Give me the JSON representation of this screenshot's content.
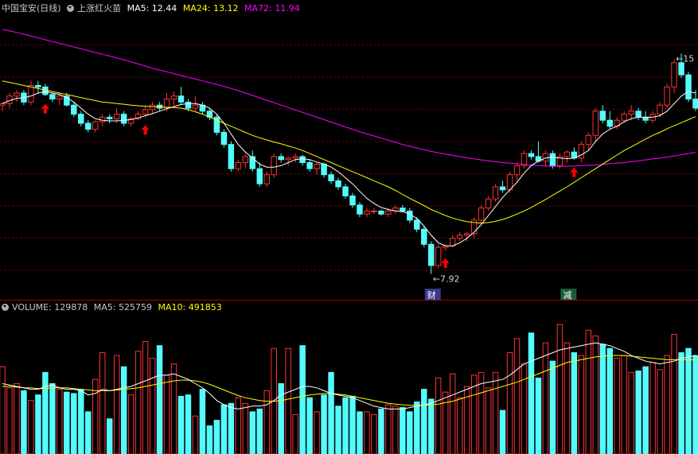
{
  "price_header": {
    "stock_name": "中国宝安(日线)",
    "indicator_name": "上涨红火苗",
    "ma5": "MA5: 12.44",
    "ma24": "MA24: 13.12",
    "ma72": "MA72: 11.94"
  },
  "volume_header": {
    "volume": "VOLUME: 129878",
    "ma5": "MA5: 525759",
    "ma10": "MA10: 491853"
  },
  "colors": {
    "up": "#ff3232",
    "down": "#54fcfc",
    "ma5": "#ffffff",
    "ma24": "#ffff00",
    "ma72": "#ff00ff",
    "grid": "#7a0000",
    "arrow": "#ff0000"
  },
  "chart_data": {
    "type": "candlestick",
    "price": {
      "ylim": [
        7.2,
        16.5
      ],
      "candles": [
        [
          13.5,
          13.6,
          13.3,
          13.55
        ],
        [
          13.55,
          13.9,
          13.4,
          13.8
        ],
        [
          13.8,
          14.0,
          13.6,
          13.9
        ],
        [
          13.9,
          14.0,
          13.5,
          13.6
        ],
        [
          13.6,
          14.3,
          13.5,
          14.15
        ],
        [
          14.15,
          14.3,
          13.9,
          14.1
        ],
        [
          14.1,
          14.2,
          13.8,
          13.85
        ],
        [
          13.85,
          13.9,
          13.6,
          13.7
        ],
        [
          13.7,
          13.9,
          13.5,
          13.8
        ],
        [
          13.8,
          13.9,
          13.45,
          13.5
        ],
        [
          13.5,
          13.6,
          13.1,
          13.2
        ],
        [
          13.2,
          13.3,
          12.8,
          12.9
        ],
        [
          12.9,
          13.0,
          12.6,
          12.7
        ],
        [
          12.7,
          13.0,
          12.6,
          12.95
        ],
        [
          12.95,
          13.2,
          12.8,
          13.1
        ],
        [
          13.1,
          13.2,
          12.9,
          13.05
        ],
        [
          13.05,
          13.4,
          12.9,
          13.2
        ],
        [
          13.2,
          13.3,
          12.8,
          12.9
        ],
        [
          12.9,
          13.1,
          12.8,
          13.05
        ],
        [
          13.05,
          13.3,
          13.0,
          13.2
        ],
        [
          13.2,
          13.5,
          13.1,
          13.35
        ],
        [
          13.35,
          13.6,
          13.2,
          13.5
        ],
        [
          13.5,
          13.6,
          13.3,
          13.4
        ],
        [
          13.4,
          13.9,
          13.3,
          13.7
        ],
        [
          13.7,
          13.95,
          13.5,
          13.8
        ],
        [
          13.8,
          14.1,
          13.5,
          13.6
        ],
        [
          13.6,
          13.7,
          13.3,
          13.4
        ],
        [
          13.4,
          13.8,
          13.3,
          13.5
        ],
        [
          13.5,
          13.6,
          13.2,
          13.3
        ],
        [
          13.3,
          13.4,
          13.0,
          13.1
        ],
        [
          13.1,
          13.2,
          12.5,
          12.6
        ],
        [
          12.6,
          12.7,
          12.1,
          12.2
        ],
        [
          12.2,
          12.3,
          11.3,
          11.4
        ],
        [
          11.4,
          11.7,
          11.3,
          11.6
        ],
        [
          11.6,
          11.9,
          11.4,
          11.8
        ],
        [
          11.8,
          12.0,
          11.3,
          11.4
        ],
        [
          11.4,
          11.6,
          10.8,
          10.9
        ],
        [
          10.9,
          11.3,
          10.8,
          11.2
        ],
        [
          11.2,
          11.9,
          11.1,
          11.8
        ],
        [
          11.8,
          11.9,
          11.6,
          11.7
        ],
        [
          11.7,
          11.8,
          11.5,
          11.75
        ],
        [
          11.75,
          11.9,
          11.6,
          11.8
        ],
        [
          11.8,
          11.85,
          11.5,
          11.6
        ],
        [
          11.6,
          11.7,
          11.3,
          11.4
        ],
        [
          11.4,
          11.6,
          11.2,
          11.55
        ],
        [
          11.55,
          11.6,
          11.1,
          11.2
        ],
        [
          11.2,
          11.3,
          10.9,
          11.0
        ],
        [
          11.0,
          11.1,
          10.7,
          10.8
        ],
        [
          10.8,
          10.9,
          10.4,
          10.5
        ],
        [
          10.5,
          10.6,
          10.1,
          10.2
        ],
        [
          10.2,
          10.3,
          9.8,
          9.9
        ],
        [
          9.9,
          10.1,
          9.8,
          10.0
        ],
        [
          10.0,
          10.1,
          9.9,
          10.0
        ],
        [
          10.0,
          10.05,
          9.85,
          9.9
        ],
        [
          9.9,
          10.1,
          9.8,
          10.0
        ],
        [
          10.0,
          10.2,
          9.9,
          10.1
        ],
        [
          10.1,
          10.2,
          9.95,
          10.0
        ],
        [
          10.0,
          10.1,
          9.6,
          9.7
        ],
        [
          9.7,
          9.8,
          9.3,
          9.4
        ],
        [
          9.4,
          9.5,
          8.8,
          8.9
        ],
        [
          8.9,
          9.0,
          7.92,
          8.2
        ],
        [
          8.2,
          8.9,
          8.1,
          8.8
        ],
        [
          8.8,
          8.9,
          8.7,
          8.85
        ],
        [
          8.85,
          9.2,
          8.8,
          9.1
        ],
        [
          9.1,
          9.3,
          9.0,
          9.2
        ],
        [
          9.2,
          9.3,
          9.0,
          9.25
        ],
        [
          9.25,
          9.8,
          9.1,
          9.7
        ],
        [
          9.7,
          10.2,
          9.6,
          10.1
        ],
        [
          10.1,
          10.5,
          10.0,
          10.4
        ],
        [
          10.4,
          10.9,
          10.3,
          10.8
        ],
        [
          10.8,
          11.0,
          10.6,
          10.7
        ],
        [
          10.7,
          11.3,
          10.6,
          11.2
        ],
        [
          11.2,
          11.6,
          11.0,
          11.5
        ],
        [
          11.5,
          12.0,
          11.4,
          11.9
        ],
        [
          11.9,
          12.0,
          11.7,
          11.8
        ],
        [
          11.8,
          12.3,
          11.6,
          11.65
        ],
        [
          11.65,
          12.0,
          11.5,
          11.9
        ],
        [
          11.9,
          12.0,
          11.4,
          11.5
        ],
        [
          11.5,
          11.9,
          11.4,
          11.8
        ],
        [
          11.8,
          12.0,
          11.6,
          11.95
        ],
        [
          11.95,
          12.1,
          11.7,
          11.75
        ],
        [
          11.75,
          12.3,
          11.6,
          12.2
        ],
        [
          12.2,
          12.6,
          12.0,
          12.5
        ],
        [
          12.5,
          13.4,
          12.3,
          13.3
        ],
        [
          13.3,
          13.5,
          12.9,
          13.0
        ],
        [
          13.0,
          13.3,
          12.7,
          12.8
        ],
        [
          12.8,
          13.1,
          12.7,
          13.0
        ],
        [
          13.0,
          13.3,
          12.9,
          13.2
        ],
        [
          13.2,
          13.5,
          13.0,
          13.3
        ],
        [
          13.3,
          13.4,
          13.0,
          13.1
        ],
        [
          13.1,
          13.3,
          12.9,
          13.0
        ],
        [
          13.0,
          13.3,
          12.9,
          13.2
        ],
        [
          13.2,
          13.6,
          13.1,
          13.5
        ],
        [
          13.5,
          14.2,
          13.4,
          14.1
        ],
        [
          14.1,
          15.0,
          13.9,
          14.9
        ],
        [
          14.9,
          15.2,
          14.4,
          14.5
        ],
        [
          14.5,
          14.6,
          13.6,
          13.7
        ],
        [
          13.7,
          14.0,
          13.3,
          13.4
        ]
      ],
      "ma5": [
        13.55,
        13.65,
        13.72,
        13.75,
        13.8,
        13.9,
        13.95,
        13.9,
        13.85,
        13.75,
        13.6,
        13.4,
        13.2,
        13.05,
        13.0,
        12.98,
        12.98,
        13.0,
        13.02,
        13.08,
        13.15,
        13.22,
        13.3,
        13.38,
        13.45,
        13.52,
        13.55,
        13.55,
        13.5,
        13.4,
        13.2,
        12.9,
        12.55,
        12.2,
        11.95,
        11.75,
        11.55,
        11.45,
        11.45,
        11.5,
        11.6,
        11.7,
        11.73,
        11.7,
        11.62,
        11.55,
        11.45,
        11.3,
        11.1,
        10.9,
        10.65,
        10.42,
        10.25,
        10.12,
        10.05,
        10.0,
        9.98,
        9.9,
        9.75,
        9.5,
        9.2,
        8.95,
        8.85,
        8.85,
        8.95,
        9.1,
        9.3,
        9.55,
        9.85,
        10.15,
        10.45,
        10.7,
        10.95,
        11.25,
        11.5,
        11.65,
        11.75,
        11.78,
        11.75,
        11.73,
        11.75,
        11.85,
        12.0,
        12.3,
        12.55,
        12.7,
        12.8,
        12.95,
        13.05,
        13.1,
        13.1,
        13.1,
        13.15,
        13.3,
        13.55,
        13.8,
        13.95,
        13.9
      ],
      "ma24": [
        14.3,
        14.25,
        14.2,
        14.15,
        14.1,
        14.05,
        14.0,
        13.95,
        13.9,
        13.85,
        13.8,
        13.75,
        13.7,
        13.65,
        13.6,
        13.58,
        13.55,
        13.53,
        13.5,
        13.48,
        13.46,
        13.45,
        13.44,
        13.43,
        13.42,
        13.4,
        13.35,
        13.28,
        13.2,
        13.1,
        13.0,
        12.9,
        12.8,
        12.7,
        12.6,
        12.5,
        12.42,
        12.35,
        12.28,
        12.22,
        12.15,
        12.08,
        12.0,
        11.9,
        11.8,
        11.7,
        11.6,
        11.5,
        11.4,
        11.3,
        11.2,
        11.1,
        11.0,
        10.9,
        10.8,
        10.68,
        10.55,
        10.42,
        10.3,
        10.18,
        10.05,
        9.95,
        9.85,
        9.77,
        9.7,
        9.65,
        9.62,
        9.6,
        9.62,
        9.66,
        9.72,
        9.8,
        9.9,
        10.0,
        10.12,
        10.25,
        10.38,
        10.52,
        10.66,
        10.8,
        10.95,
        11.1,
        11.25,
        11.4,
        11.55,
        11.7,
        11.85,
        12.0,
        12.12,
        12.25,
        12.38,
        12.5,
        12.6,
        12.72,
        12.82,
        12.92,
        13.02,
        13.12
      ],
      "ma72": [
        16.0,
        15.95,
        15.9,
        15.84,
        15.78,
        15.72,
        15.66,
        15.6,
        15.54,
        15.48,
        15.42,
        15.36,
        15.3,
        15.24,
        15.18,
        15.12,
        15.06,
        15.0,
        14.93,
        14.86,
        14.79,
        14.72,
        14.66,
        14.6,
        14.54,
        14.48,
        14.42,
        14.36,
        14.3,
        14.24,
        14.18,
        14.12,
        14.05,
        13.98,
        13.9,
        13.82,
        13.74,
        13.66,
        13.58,
        13.5,
        13.42,
        13.34,
        13.26,
        13.18,
        13.1,
        13.02,
        12.94,
        12.86,
        12.78,
        12.7,
        12.62,
        12.55,
        12.48,
        12.41,
        12.34,
        12.27,
        12.2,
        12.14,
        12.08,
        12.02,
        11.97,
        11.92,
        11.88,
        11.84,
        11.8,
        11.76,
        11.72,
        11.69,
        11.66,
        11.63,
        11.6,
        11.58,
        11.56,
        11.54,
        11.52,
        11.5,
        11.49,
        11.48,
        11.48,
        11.48,
        11.49,
        11.5,
        11.51,
        11.52,
        11.54,
        11.56,
        11.58,
        11.6,
        11.63,
        11.66,
        11.69,
        11.72,
        11.75,
        11.78,
        11.82,
        11.86,
        11.9,
        11.94
      ],
      "up_arrows": [
        6,
        20,
        62,
        80
      ],
      "annotations": [
        {
          "text": "←7.92",
          "index": 60,
          "value": 7.92
        },
        {
          "text": "←15",
          "index": 94,
          "value": 15.2
        }
      ],
      "event_tags": [
        {
          "text": "财",
          "index": 60
        },
        {
          "text": "减",
          "index": 79
        }
      ]
    },
    "volume": {
      "ylim": [
        0,
        1000000
      ],
      "values": [
        620000,
        470000,
        500000,
        450000,
        380000,
        420000,
        580000,
        500000,
        460000,
        440000,
        430000,
        460000,
        300000,
        530000,
        720000,
        250000,
        700000,
        620000,
        420000,
        730000,
        800000,
        680000,
        770000,
        560000,
        640000,
        410000,
        420000,
        270000,
        460000,
        200000,
        240000,
        350000,
        360000,
        400000,
        360000,
        300000,
        320000,
        450000,
        750000,
        500000,
        750000,
        280000,
        770000,
        400000,
        300000,
        420000,
        580000,
        340000,
        400000,
        410000,
        300000,
        300000,
        280000,
        320000,
        350000,
        340000,
        330000,
        300000,
        370000,
        460000,
        390000,
        540000,
        440000,
        570000,
        400000,
        480000,
        560000,
        580000,
        470000,
        580000,
        310000,
        720000,
        820000,
        640000,
        860000,
        540000,
        790000,
        660000,
        920000,
        790000,
        720000,
        700000,
        880000,
        840000,
        780000,
        750000,
        680000,
        700000,
        580000,
        590000,
        620000,
        650000,
        600000,
        700000,
        850000,
        720000,
        750000,
        700000
      ],
      "ma5": [
        500000,
        490000,
        480000,
        470000,
        460000,
        460000,
        480000,
        490000,
        470000,
        460000,
        460000,
        450000,
        420000,
        430000,
        460000,
        450000,
        460000,
        470000,
        480000,
        500000,
        520000,
        540000,
        560000,
        560000,
        570000,
        550000,
        530000,
        500000,
        470000,
        430000,
        380000,
        350000,
        330000,
        320000,
        330000,
        340000,
        340000,
        350000,
        380000,
        420000,
        440000,
        460000,
        480000,
        480000,
        470000,
        450000,
        430000,
        420000,
        410000,
        400000,
        380000,
        360000,
        340000,
        330000,
        320000,
        320000,
        320000,
        330000,
        340000,
        350000,
        360000,
        380000,
        400000,
        420000,
        440000,
        460000,
        480000,
        500000,
        510000,
        520000,
        530000,
        560000,
        600000,
        640000,
        660000,
        680000,
        700000,
        720000,
        740000,
        750000,
        760000,
        770000,
        780000,
        790000,
        780000,
        770000,
        750000,
        730000,
        700000,
        680000,
        660000,
        650000,
        640000,
        650000,
        660000,
        680000,
        690000,
        700000
      ],
      "ma10": [
        480000,
        480000,
        475000,
        470000,
        470000,
        465000,
        465000,
        470000,
        470000,
        470000,
        465000,
        460000,
        455000,
        450000,
        450000,
        450000,
        455000,
        460000,
        465000,
        470000,
        480000,
        490000,
        500000,
        510000,
        520000,
        525000,
        525000,
        520000,
        510000,
        495000,
        475000,
        455000,
        435000,
        415000,
        400000,
        390000,
        380000,
        375000,
        375000,
        380000,
        390000,
        400000,
        410000,
        420000,
        425000,
        430000,
        430000,
        425000,
        420000,
        410000,
        400000,
        390000,
        380000,
        370000,
        360000,
        355000,
        350000,
        345000,
        345000,
        345000,
        350000,
        355000,
        365000,
        375000,
        390000,
        405000,
        420000,
        435000,
        450000,
        465000,
        480000,
        495000,
        510000,
        530000,
        550000,
        570000,
        590000,
        610000,
        630000,
        650000,
        660000,
        670000,
        680000,
        690000,
        695000,
        700000,
        700000,
        700000,
        695000,
        690000,
        685000,
        680000,
        675000,
        670000,
        670000,
        670000,
        670000,
        670000
      ]
    }
  }
}
